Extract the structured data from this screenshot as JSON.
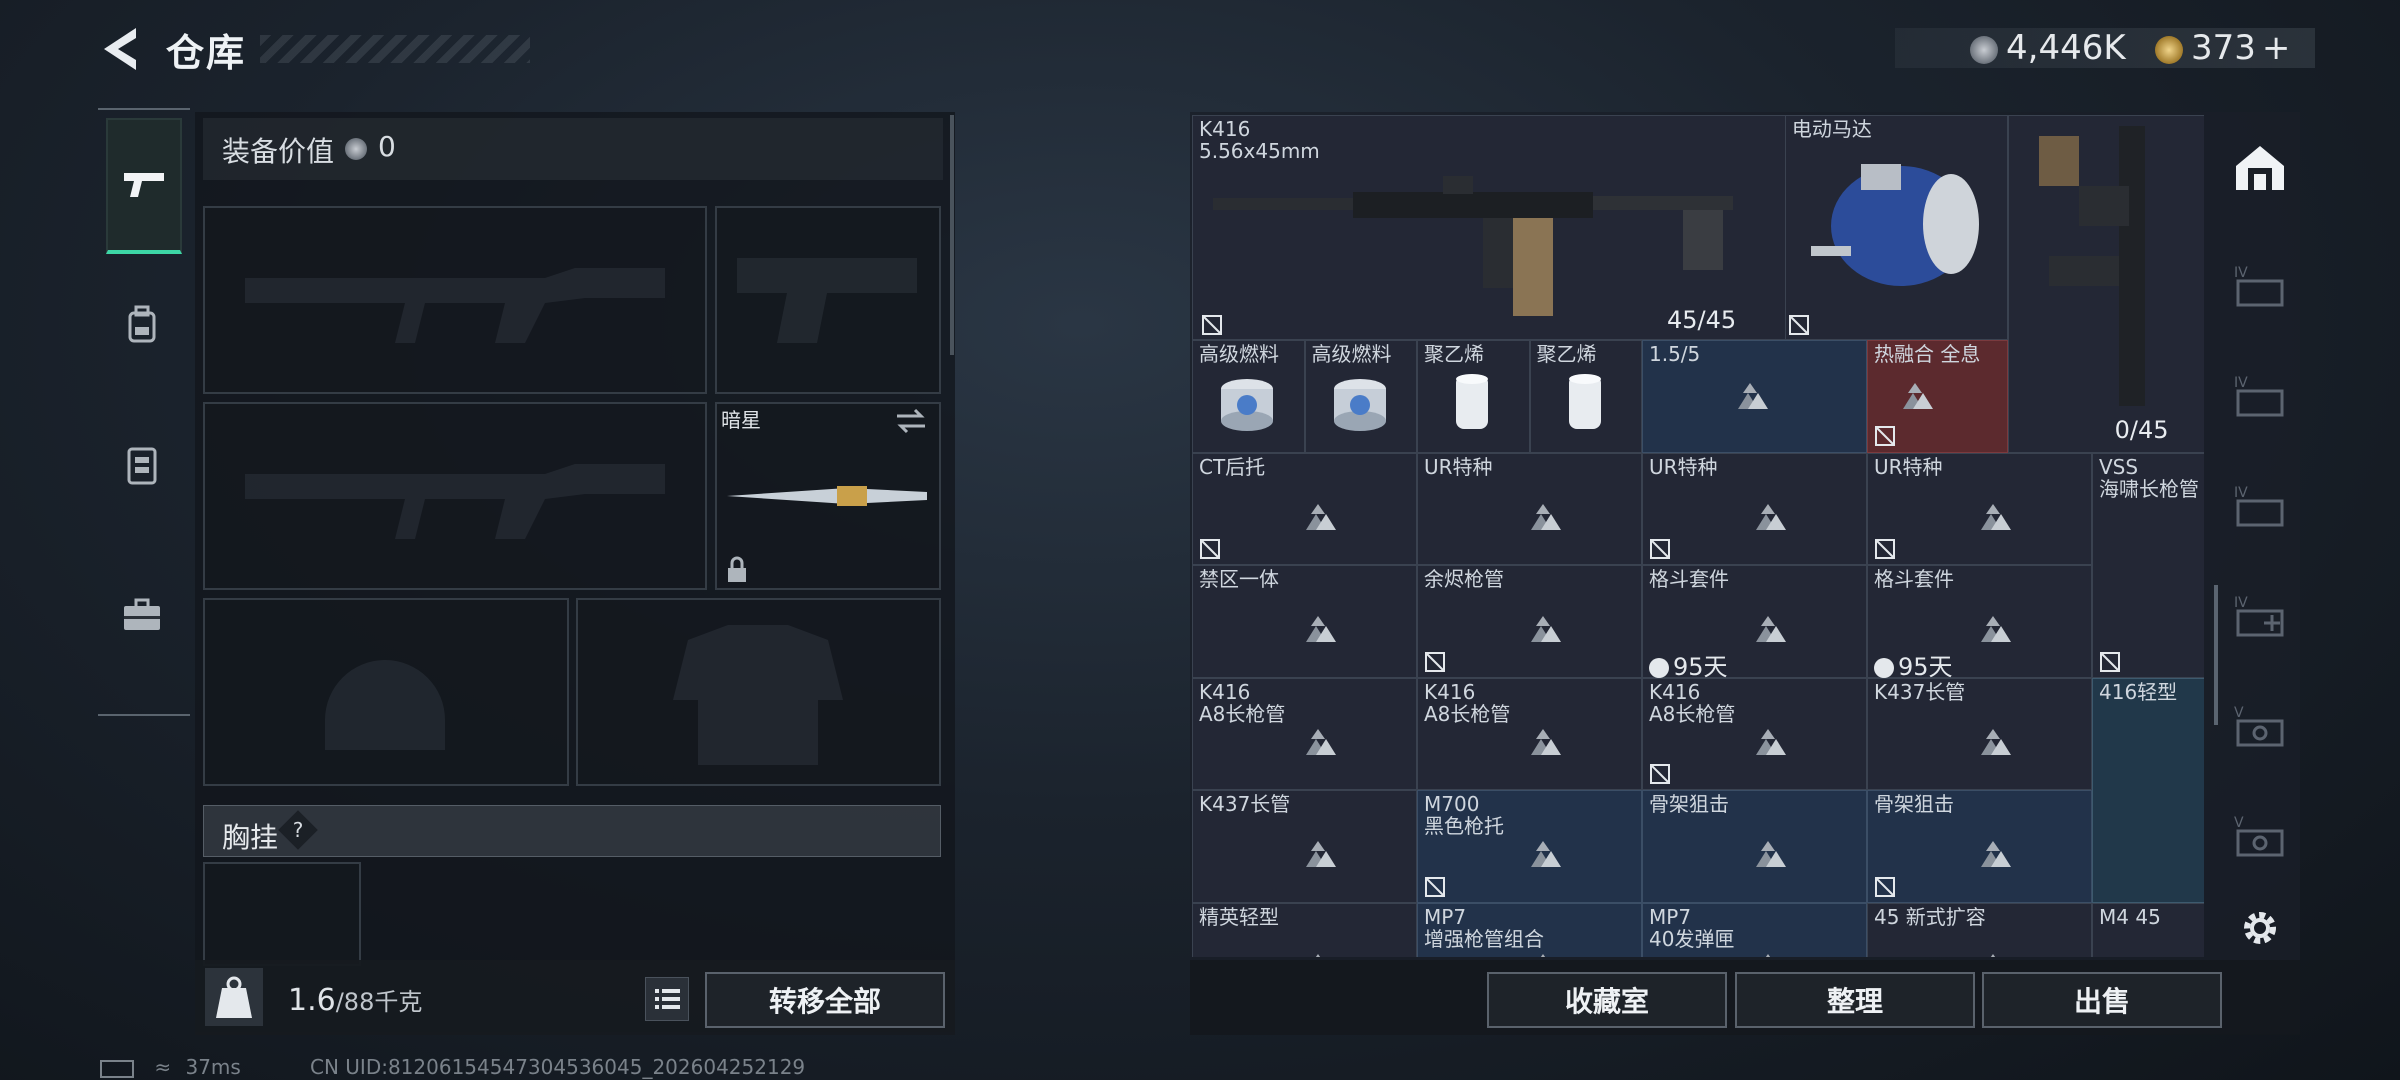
{
  "header": {
    "title": "仓库",
    "currency_silver": "4,446K",
    "currency_gold": "373"
  },
  "colors": {
    "accent_green": "#3dd6a6",
    "red_cell": "#5c2a2e",
    "blue_cell": "#22324a"
  },
  "left_nav": {
    "items": [
      {
        "name": "weapons",
        "icon": "pistol-icon"
      },
      {
        "name": "gear",
        "icon": "backpack-icon"
      },
      {
        "name": "armor",
        "icon": "vest-icon"
      },
      {
        "name": "toolbox",
        "icon": "toolbox-icon"
      }
    ]
  },
  "equipment": {
    "value_label": "装备价值",
    "value": "0",
    "knife_name": "暗星",
    "chest_label": "胸挂",
    "chest_help": "?"
  },
  "bottom_left": {
    "weight": "1.6",
    "weight_max": "/88千克",
    "transfer_label": "转移全部"
  },
  "inventory": {
    "big_item": {
      "name": "K416",
      "caliber": "5.56x45mm",
      "ammo": "45/45"
    },
    "motor": {
      "name": "电动马达"
    },
    "side_weapon": {
      "ammo": "0/45"
    },
    "row2": [
      {
        "name": "高级燃料"
      },
      {
        "name": "高级燃料"
      },
      {
        "name": "聚乙烯"
      },
      {
        "name": "聚乙烯"
      },
      {
        "name": "1.5/5"
      },
      {
        "name": "热融合 全息"
      }
    ],
    "cells": [
      {
        "name": "CT后托"
      },
      {
        "name": "UR特种"
      },
      {
        "name": "UR特种"
      },
      {
        "name": "UR特种"
      },
      {
        "name": "VSS\n海啸长枪管"
      },
      {
        "name": "禁区一体"
      },
      {
        "name": "余烬枪管"
      },
      {
        "name": "格斗套件",
        "timer": "95天"
      },
      {
        "name": "格斗套件",
        "timer": "95天"
      },
      {
        "name": "K416\nA8长枪管"
      },
      {
        "name": "K416\nA8长枪管"
      },
      {
        "name": "K416\nA8长枪管"
      },
      {
        "name": "K437长管"
      },
      {
        "name": "416轻型"
      },
      {
        "name": "K437长管"
      },
      {
        "name": "M700\n黑色枪托"
      },
      {
        "name": "骨架狙击"
      },
      {
        "name": "骨架狙击"
      },
      {
        "name": "精英轻型"
      },
      {
        "name": "MP7\n增强枪管组合"
      },
      {
        "name": "MP7\n40发弹匣"
      },
      {
        "name": "45 新式扩容"
      },
      {
        "name": "M4 45"
      }
    ]
  },
  "bottom_right": {
    "collection_label": "收藏室",
    "sort_label": "整理",
    "sell_label": "出售"
  },
  "status": {
    "ping": "37ms",
    "uid": "CN UID:8120615454730453604​5_202604252129"
  }
}
